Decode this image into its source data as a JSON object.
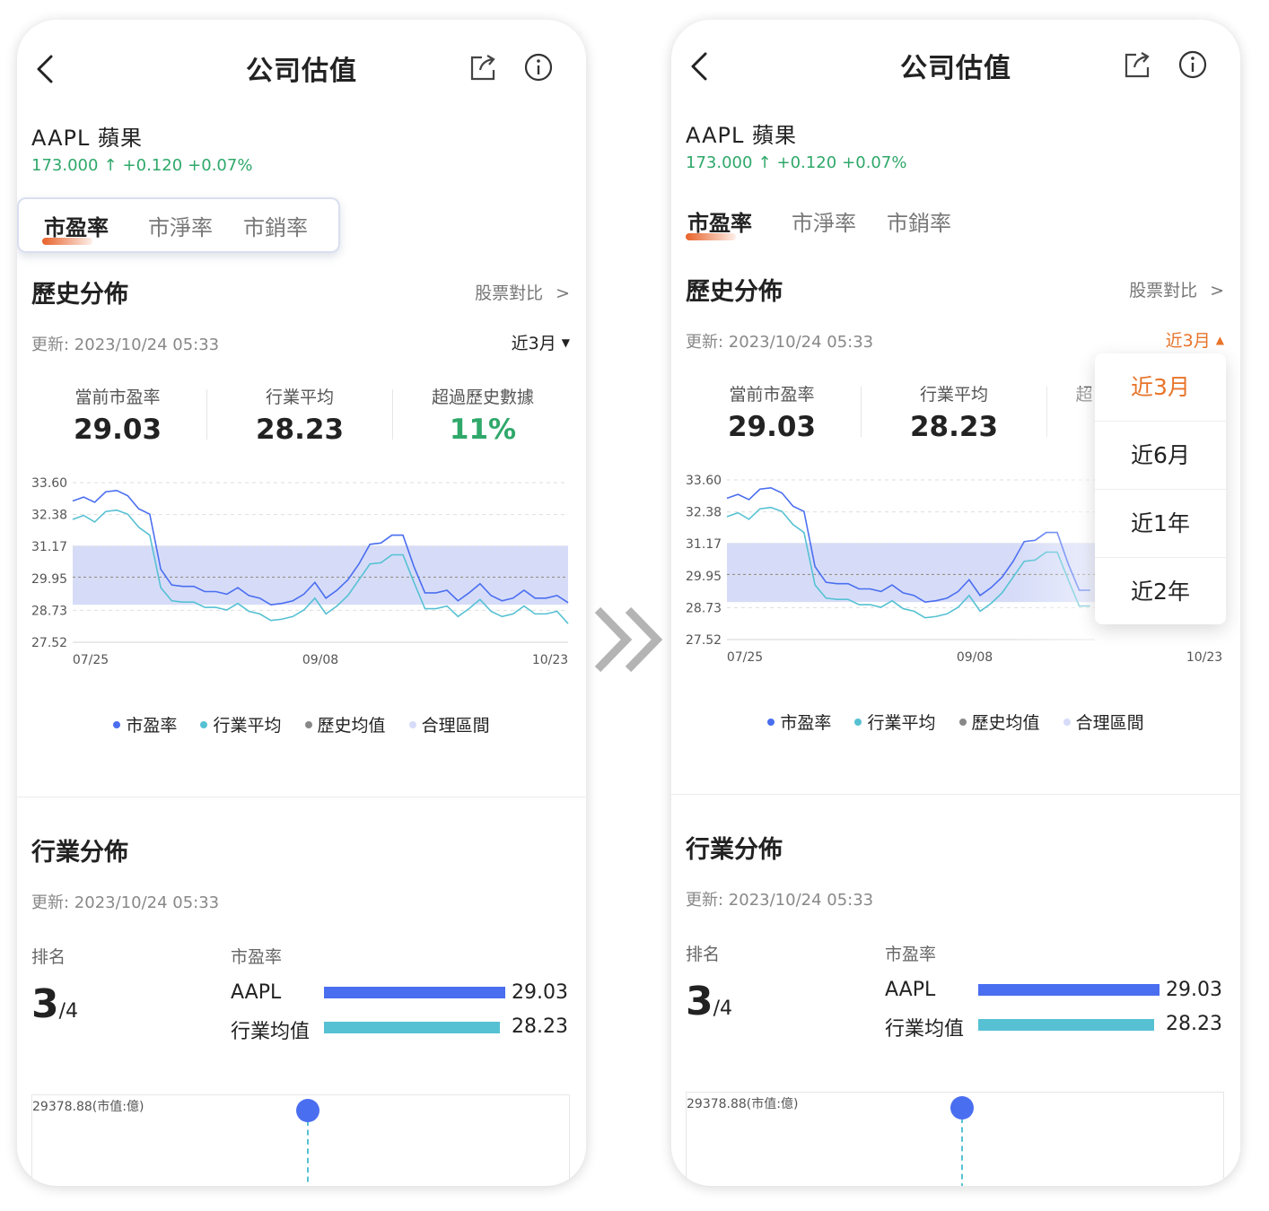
{
  "screens": [
    {
      "id": "left",
      "header": {
        "title": "公司估值"
      },
      "stock": {
        "name": "AAPL  蘋果",
        "price": "173.000",
        "up_arrow": "↑",
        "change": "+0.120",
        "change_pct": "+0.07%"
      },
      "tabs": [
        {
          "label": "市盈率",
          "active": true
        },
        {
          "label": "市淨率",
          "active": false
        },
        {
          "label": "市銷率",
          "active": false
        }
      ],
      "history": {
        "title": "歷史分佈",
        "compare_label": "股票對比",
        "update": "更新:  2023/10/24 05:33",
        "period": "近3月"
      },
      "stats": [
        {
          "label": "當前市盈率",
          "value": "29.03"
        },
        {
          "label": "行業平均",
          "value": "28.23"
        },
        {
          "label": "超過歷史數據",
          "value": "11%"
        }
      ],
      "legend": [
        "市盈率",
        "行業平均",
        "歷史均值",
        "合理區間"
      ],
      "industry": {
        "title": "行業分佈",
        "update": "更新:  2023/10/24 05:33",
        "rank_label": "排名",
        "rank": "3",
        "rank_total": "/4",
        "metric_label": "市盈率",
        "bars": [
          {
            "name": "AAPL",
            "value": "29.03"
          },
          {
            "name": "行業均值",
            "value": "28.23"
          }
        ],
        "scatter_caption": "29378.88(市值:億)"
      }
    },
    {
      "id": "right",
      "header": {
        "title": "公司估值"
      },
      "stock": {
        "name": "AAPL  蘋果",
        "price": "173.000",
        "up_arrow": "↑",
        "change": "+0.120",
        "change_pct": "+0.07%"
      },
      "tabs": [
        {
          "label": "市盈率",
          "active": true
        },
        {
          "label": "市淨率",
          "active": false
        },
        {
          "label": "市銷率",
          "active": false
        }
      ],
      "history": {
        "title": "歷史分佈",
        "compare_label": "股票對比",
        "update": "更新:  2023/10/24 05:33",
        "period": "近3月"
      },
      "stats": [
        {
          "label": "當前市盈率",
          "value": "29.03"
        },
        {
          "label": "行業平均",
          "value": "28.23"
        },
        {
          "label": "超",
          "value": ""
        }
      ],
      "dropdown": {
        "options": [
          "近3月",
          "近6月",
          "近1年",
          "近2年"
        ],
        "selected": "近3月"
      },
      "legend": [
        "市盈率",
        "行業平均",
        "歷史均值",
        "合理區間"
      ],
      "industry": {
        "title": "行業分佈",
        "update": "更新:  2023/10/24 05:33",
        "rank_label": "排名",
        "rank": "3",
        "rank_total": "/4",
        "metric_label": "市盈率",
        "bars": [
          {
            "name": "AAPL",
            "value": "29.03"
          },
          {
            "name": "行業均值",
            "value": "28.23"
          }
        ],
        "scatter_caption": "29378.88(市值:億)"
      }
    }
  ],
  "colors": {
    "pe": "#4a6ef0",
    "industry": "#56c1d3",
    "mean": "#888888",
    "band": "#d6dcf8",
    "up": "#2fa86a",
    "accent": "#e8742a"
  },
  "icons": {
    "back": "chevron-left-icon",
    "share": "share-icon",
    "info": "info-icon",
    "transition": "double-chevron-right-icon"
  },
  "chart_data": {
    "type": "line",
    "x": [
      "07/25",
      "07/27",
      "07/29",
      "07/31",
      "08/02",
      "08/04",
      "08/06",
      "08/08",
      "08/10",
      "08/12",
      "08/14",
      "08/16",
      "08/18",
      "08/20",
      "08/22",
      "08/24",
      "08/26",
      "08/28",
      "08/30",
      "09/01",
      "09/03",
      "09/05",
      "09/07",
      "09/09",
      "09/11",
      "09/13",
      "09/15",
      "09/17",
      "09/19",
      "09/21",
      "09/23",
      "09/25",
      "09/27",
      "09/29",
      "10/01",
      "10/03",
      "10/05",
      "10/07",
      "10/09",
      "10/11",
      "10/13",
      "10/15",
      "10/17",
      "10/19",
      "10/21",
      "10/23"
    ],
    "x_ticks": [
      "07/25",
      "09/08",
      "10/23"
    ],
    "y_ticks": [
      "33.60",
      "32.38",
      "31.17",
      "29.95",
      "28.73",
      "27.52"
    ],
    "ylim": [
      27.52,
      33.6
    ],
    "series": [
      {
        "name": "市盈率",
        "values": [
          32.9,
          33.05,
          32.85,
          33.25,
          33.3,
          33.1,
          32.6,
          32.4,
          30.3,
          29.7,
          29.65,
          29.65,
          29.45,
          29.45,
          29.35,
          29.6,
          29.3,
          29.2,
          28.95,
          29.0,
          29.1,
          29.35,
          29.8,
          29.2,
          29.5,
          29.9,
          30.5,
          31.25,
          31.3,
          31.6,
          31.6,
          30.4,
          29.4,
          29.4,
          29.5,
          29.1,
          29.4,
          29.75,
          29.3,
          29.1,
          29.2,
          29.5,
          29.2,
          29.2,
          29.3,
          29.03
        ]
      },
      {
        "name": "行業平均",
        "values": [
          32.2,
          32.35,
          32.1,
          32.5,
          32.55,
          32.4,
          31.9,
          31.6,
          29.6,
          29.1,
          29.05,
          29.05,
          28.85,
          28.85,
          28.75,
          29.0,
          28.7,
          28.6,
          28.35,
          28.4,
          28.5,
          28.75,
          29.2,
          28.6,
          28.9,
          29.3,
          29.9,
          30.5,
          30.55,
          30.85,
          30.85,
          29.8,
          28.8,
          28.8,
          28.9,
          28.5,
          28.8,
          29.15,
          28.7,
          28.5,
          28.6,
          28.9,
          28.6,
          28.6,
          28.7,
          28.23
        ]
      }
    ],
    "historical_mean": 30.0,
    "reasonable_range": [
      28.95,
      31.2
    ]
  }
}
